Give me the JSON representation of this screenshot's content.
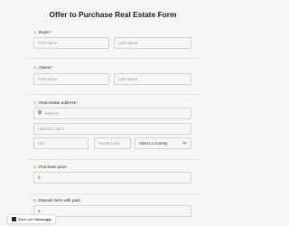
{
  "form": {
    "title": "Offer to Purchase Real Estate Form",
    "sections": {
      "buyer": {
        "num": "1.",
        "label": "Buyer",
        "req": "*",
        "first_placeholder": "First Name",
        "last_placeholder": "Last Name"
      },
      "owner": {
        "num": "2.",
        "label": "Owner",
        "req": "*",
        "first_placeholder": "First Name",
        "last_placeholder": "Last Name"
      },
      "address": {
        "num": "3.",
        "label": "Real estate address",
        "req": "*",
        "address_placeholder": "Address",
        "address2_placeholder": "Address Line 2",
        "city_placeholder": "City",
        "postal_placeholder": "Postal Code",
        "country_value": "Select a country",
        "pin_icon": "map-pin-icon",
        "chevron_icon": "chevron-down-icon"
      },
      "price": {
        "num": "4.",
        "label": "Purchase price",
        "currency": "$"
      },
      "deposit": {
        "num": "5.",
        "label": "Deposit here with paid",
        "currency": "$"
      }
    }
  },
  "footer": {
    "badge_prefix": "Made with",
    "badge_brand": "forms.app"
  },
  "colors": {
    "accent": "#e0a02a",
    "required": "#dd3333",
    "background": "#f6f6f7"
  }
}
